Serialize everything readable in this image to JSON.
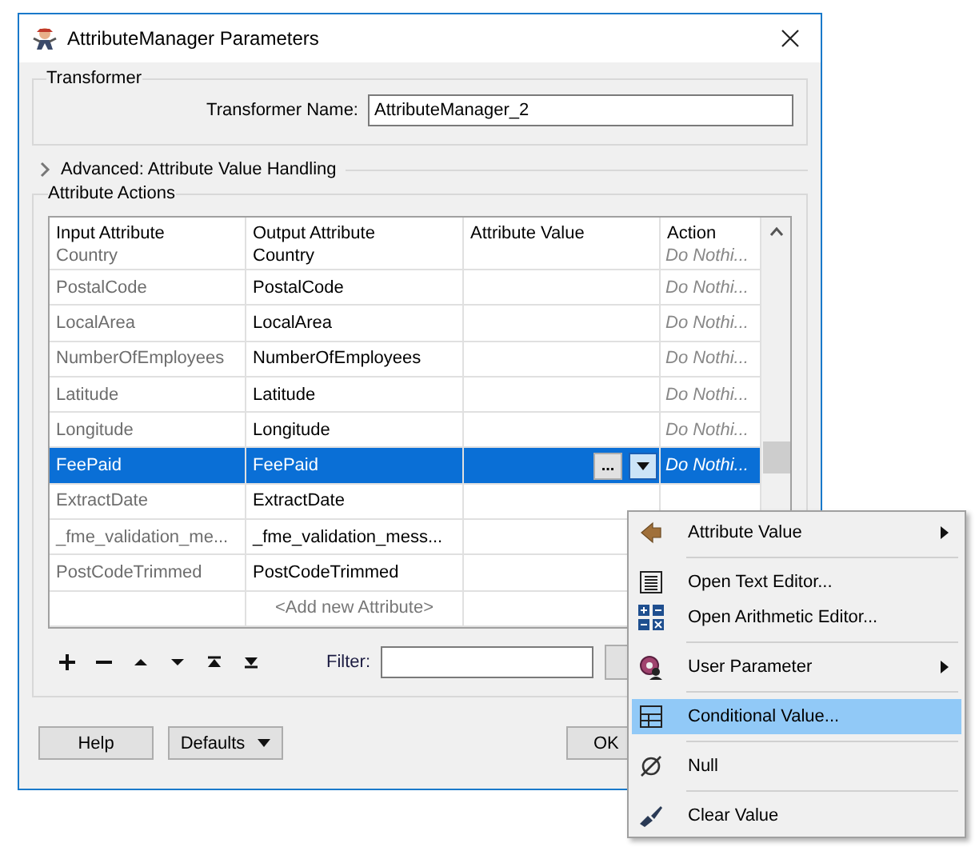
{
  "window": {
    "title": "AttributeManager Parameters"
  },
  "transformer": {
    "group_label": "Transformer",
    "name_label": "Transformer Name:",
    "name_value": "AttributeManager_2"
  },
  "advanced": {
    "label": "Advanced: Attribute Value Handling",
    "expanded": false
  },
  "attribute_actions": {
    "group_label": "Attribute Actions",
    "table": {
      "columns": [
        "Input Attribute",
        "Output Attribute",
        "Attribute Value",
        "Action"
      ],
      "rows": [
        {
          "input": "Country",
          "output": "Country",
          "action": "Do Nothi...",
          "selected": false
        },
        {
          "input": "PostalCode",
          "output": "PostalCode",
          "action": "Do Nothi...",
          "selected": false
        },
        {
          "input": "LocalArea",
          "output": "LocalArea",
          "action": "Do Nothi...",
          "selected": false
        },
        {
          "input": "NumberOfEmployees",
          "output": "NumberOfEmployees",
          "action": "Do Nothi...",
          "selected": false
        },
        {
          "input": "Latitude",
          "output": "Latitude",
          "action": "Do Nothi...",
          "selected": false
        },
        {
          "input": "Longitude",
          "output": "Longitude",
          "action": "Do Nothi...",
          "selected": false
        },
        {
          "input": "FeePaid",
          "output": "FeePaid",
          "action": "Do Nothi...",
          "selected": true
        },
        {
          "input": "ExtractDate",
          "output": "ExtractDate",
          "selected": false
        },
        {
          "input": "_fme_validation_me...",
          "output": "_fme_validation_mess...",
          "selected": false
        },
        {
          "input": "PostCodeTrimmed",
          "output": "PostCodeTrimmed",
          "selected": false
        }
      ],
      "add_row": "<Add new Attribute>",
      "value_button": "..."
    },
    "filter_label": "Filter:"
  },
  "footer": {
    "buttons": [
      {
        "label": "Help",
        "kind": "plain"
      },
      {
        "label": "Defaults",
        "kind": "dropdown"
      },
      {
        "label": "OK",
        "kind": "plain"
      }
    ]
  },
  "context_menu": {
    "items": [
      {
        "kind": "item",
        "label": "Attribute Value",
        "submenu": true,
        "selected": false
      },
      {
        "kind": "separator"
      },
      {
        "kind": "item",
        "label": "Open Text Editor...",
        "submenu": false,
        "selected": false
      },
      {
        "kind": "item",
        "label": "Open Arithmetic Editor...",
        "submenu": false,
        "selected": false
      },
      {
        "kind": "separator"
      },
      {
        "kind": "item",
        "label": "User Parameter",
        "submenu": true,
        "selected": false
      },
      {
        "kind": "separator"
      },
      {
        "kind": "item",
        "label": "Conditional Value...",
        "submenu": false,
        "selected": true
      },
      {
        "kind": "separator"
      },
      {
        "kind": "item",
        "label": "Null",
        "submenu": false,
        "selected": false
      },
      {
        "kind": "separator"
      },
      {
        "kind": "item",
        "label": "Clear Value",
        "submenu": false,
        "selected": false
      }
    ]
  }
}
